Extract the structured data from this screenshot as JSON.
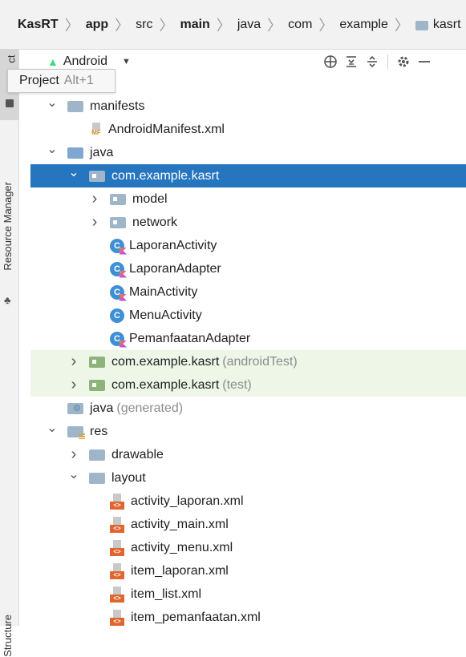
{
  "breadcrumb": [
    {
      "label": "KasRT",
      "bold": true
    },
    {
      "label": "app",
      "bold": true
    },
    {
      "label": "src",
      "bold": false
    },
    {
      "label": "main",
      "bold": true
    },
    {
      "label": "java",
      "bold": false
    },
    {
      "label": "com",
      "bold": false
    },
    {
      "label": "example",
      "bold": false
    },
    {
      "label": "kasrt",
      "bold": false,
      "folder_icon": true
    }
  ],
  "leftbar": {
    "project_tab_mark": "ct",
    "resource_manager": "Resource Manager",
    "structure": "Structure"
  },
  "pane_header": {
    "view_label": "Android",
    "view_icon": "android-icon",
    "icons": [
      "crosshair-icon",
      "collapse-all-icon",
      "expand-all-icon",
      "gear-icon",
      "minimize-icon"
    ]
  },
  "tooltip": {
    "label": "Project",
    "shortcut": "Alt+1"
  },
  "tree": [
    {
      "kind": "folder",
      "indent": 1,
      "arrow": "down",
      "label": "manifests",
      "icon": "folder"
    },
    {
      "kind": "mf",
      "indent": 2,
      "label": "AndroidManifest.xml"
    },
    {
      "kind": "folder",
      "indent": 1,
      "arrow": "down",
      "label": "java",
      "icon": "folder-blue"
    },
    {
      "kind": "package",
      "indent": 2,
      "arrow": "down",
      "label": "com.example.kasrt",
      "selected": true
    },
    {
      "kind": "package",
      "indent": 3,
      "arrow": "right",
      "label": "model"
    },
    {
      "kind": "package",
      "indent": 3,
      "arrow": "right",
      "label": "network"
    },
    {
      "kind": "kt-class",
      "indent": 3,
      "label": "LaporanActivity"
    },
    {
      "kind": "kt-class",
      "indent": 3,
      "label": "LaporanAdapter"
    },
    {
      "kind": "kt-class",
      "indent": 3,
      "label": "MainActivity"
    },
    {
      "kind": "class",
      "indent": 3,
      "label": "MenuActivity"
    },
    {
      "kind": "kt-class",
      "indent": 3,
      "label": "PemanfaatanAdapter"
    },
    {
      "kind": "test-package",
      "indent": 2,
      "arrow": "right",
      "label": "com.example.kasrt",
      "suffix": "(androidTest)"
    },
    {
      "kind": "test-package",
      "indent": 2,
      "arrow": "right",
      "label": "com.example.kasrt",
      "suffix": "(test)"
    },
    {
      "kind": "gen-folder",
      "indent": 1,
      "label": "java",
      "suffix": "(generated)"
    },
    {
      "kind": "res-folder",
      "indent": 1,
      "arrow": "down",
      "label": "res"
    },
    {
      "kind": "folder",
      "indent": 2,
      "arrow": "right",
      "label": "drawable",
      "icon": "folder"
    },
    {
      "kind": "folder",
      "indent": 2,
      "arrow": "down",
      "label": "layout",
      "icon": "folder"
    },
    {
      "kind": "xml",
      "indent": 3,
      "label": "activity_laporan.xml"
    },
    {
      "kind": "xml",
      "indent": 3,
      "label": "activity_main.xml"
    },
    {
      "kind": "xml",
      "indent": 3,
      "label": "activity_menu.xml"
    },
    {
      "kind": "xml",
      "indent": 3,
      "label": "item_laporan.xml"
    },
    {
      "kind": "xml",
      "indent": 3,
      "label": "item_list.xml"
    },
    {
      "kind": "xml",
      "indent": 3,
      "label": "item_pemanfaatan.xml"
    }
  ],
  "colors": {
    "selection": "#2675bf",
    "test_row_bg": "#eef6e8",
    "folder": "#9fb5c9",
    "android_green": "#3ddc84"
  }
}
